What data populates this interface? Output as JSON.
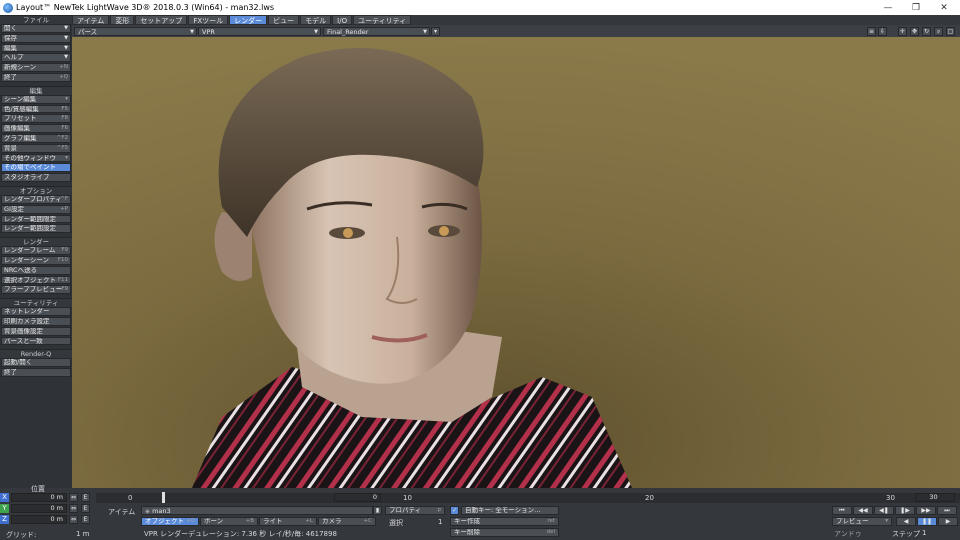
{
  "window": {
    "title": "Layout™ NewTek LightWave 3D® 2018.0.3 (Win64) - man32.lws",
    "minimize": "—",
    "maximize": "❐",
    "close": "✕"
  },
  "menu_tabs": [
    "アイテム",
    "変形",
    "セットアップ",
    "FXツール",
    "レンダー",
    "ビュー",
    "モデル",
    "I/O",
    "ユーティリティ"
  ],
  "active_tab": "レンダー",
  "viewport_bar": {
    "view_mode": "パース",
    "render_mode": "VPR",
    "camera": "Final_Render"
  },
  "sidebar": {
    "file_header": "ファイル",
    "file_items": [
      "開く",
      "保存",
      "編集",
      "ヘルプ"
    ],
    "file_extra": [
      {
        "label": "新規シーン",
        "shortcut": "+N"
      },
      {
        "label": "終了",
        "shortcut": "+Q"
      }
    ],
    "edit_header": "編集",
    "edit_items": [
      {
        "label": "シーン編集",
        "shortcut": "▾"
      },
      {
        "label": "色/質感編集",
        "shortcut": "F5"
      },
      {
        "label": "プリセット",
        "shortcut": "F8"
      },
      {
        "label": "画像編集",
        "shortcut": "F6"
      },
      {
        "label": "グラフ編集",
        "shortcut": "^F2"
      },
      {
        "label": "背景",
        "shortcut": "^F5"
      },
      {
        "label": "その他ウィンドウ",
        "shortcut": "▾"
      },
      {
        "label": "その場でペイント",
        "shortcut": ""
      },
      {
        "label": "スタジオライブ",
        "shortcut": ""
      }
    ],
    "option_header": "オプション",
    "option_items": [
      {
        "label": "レンダープロパティ",
        "shortcut": "^F"
      },
      {
        "label": "GI設定",
        "shortcut": "+P"
      },
      {
        "label": "レンダー範囲限定",
        "shortcut": ""
      },
      {
        "label": "レンダー範囲設定",
        "shortcut": ""
      }
    ],
    "render_header": "レンダー",
    "render_items": [
      {
        "label": "レンダーフレーム",
        "shortcut": "F9"
      },
      {
        "label": "レンダーシーン",
        "shortcut": "F10"
      },
      {
        "label": "NRCへ送る",
        "shortcut": ""
      },
      {
        "label": "選択オブジェクト",
        "shortcut": "F11"
      },
      {
        "label": "フラーププレビュー",
        "shortcut": "+F9"
      }
    ],
    "utility_header": "ユーティリティ",
    "utility_items": [
      "ネットレンダー",
      "印刷カメラ設定",
      "背景画像設定",
      "パースと一致"
    ],
    "renderq_header": "Render-Q",
    "renderq_items": [
      "起動/開く",
      "終了"
    ]
  },
  "bottom": {
    "position_label": "位置",
    "axes": [
      {
        "name": "X",
        "value": "0 m",
        "color": "#3f6fd0"
      },
      {
        "name": "Y",
        "value": "0 m",
        "color": "#3fa34d"
      },
      {
        "name": "Z",
        "value": "0 m",
        "color": "#3f6fd0"
      }
    ],
    "grid_label": "グリッド:",
    "grid_value": "1 m",
    "timeline_start": "0",
    "current_frame": "0",
    "ticks": [
      "10",
      "20",
      "30"
    ],
    "end_frame": "30",
    "item_label": "アイテム",
    "item_value": "man3",
    "edit_modes": [
      {
        "label": "オブジェクト",
        "shortcut": "+O"
      },
      {
        "label": "ボーン",
        "shortcut": "+B"
      },
      {
        "label": "ライト",
        "shortcut": "+L"
      },
      {
        "label": "カメラ",
        "shortcut": "+C"
      }
    ],
    "properties": "プロパティ",
    "properties_sc": "p",
    "selected_label": "選択",
    "selected_value": "1",
    "autokey": "自動キー: 全モーション…",
    "create_key": "キー作成",
    "create_key_sc": "ret",
    "delete_key": "キー削除",
    "delete_key_sc": "del",
    "status": "VPR レンダーデュレーション: 7.36 秒 レイ/秒/毎: 4617898",
    "preview": "プレビュー",
    "options_label": "アンドゥ",
    "step_label": "ステップ",
    "step_value": "1"
  }
}
